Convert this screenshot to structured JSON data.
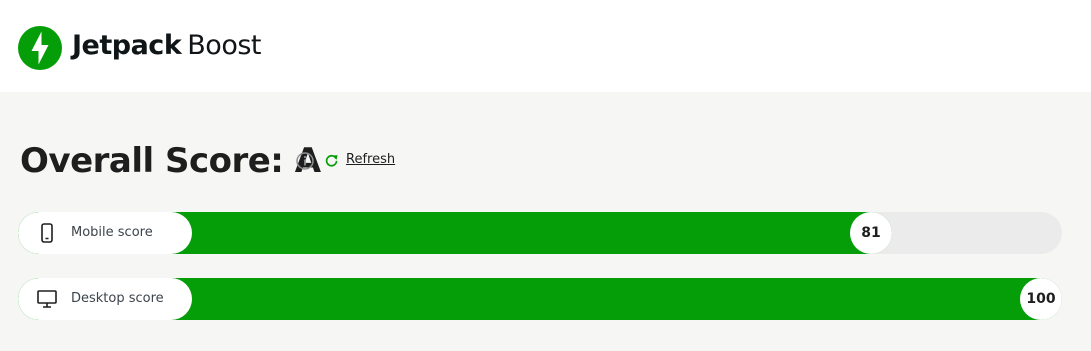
{
  "header": {
    "brand": "Jetpack",
    "product": "Boost",
    "logo_color": "#069e08"
  },
  "overall": {
    "heading": "Overall Score: A",
    "info_icon": "info-icon",
    "refresh_icon": "refresh-icon",
    "refresh_label": "Refresh"
  },
  "scores": {
    "mobile": {
      "icon": "phone-icon",
      "label": "Mobile score",
      "value": "81",
      "fraction": 0.81
    },
    "desktop": {
      "icon": "monitor-icon",
      "label": "Desktop score",
      "value": "100",
      "fraction": 1.0
    }
  },
  "colors": {
    "fill": "#069e08",
    "track": "#ebebeb",
    "page_bg": "#f6f6f4"
  }
}
